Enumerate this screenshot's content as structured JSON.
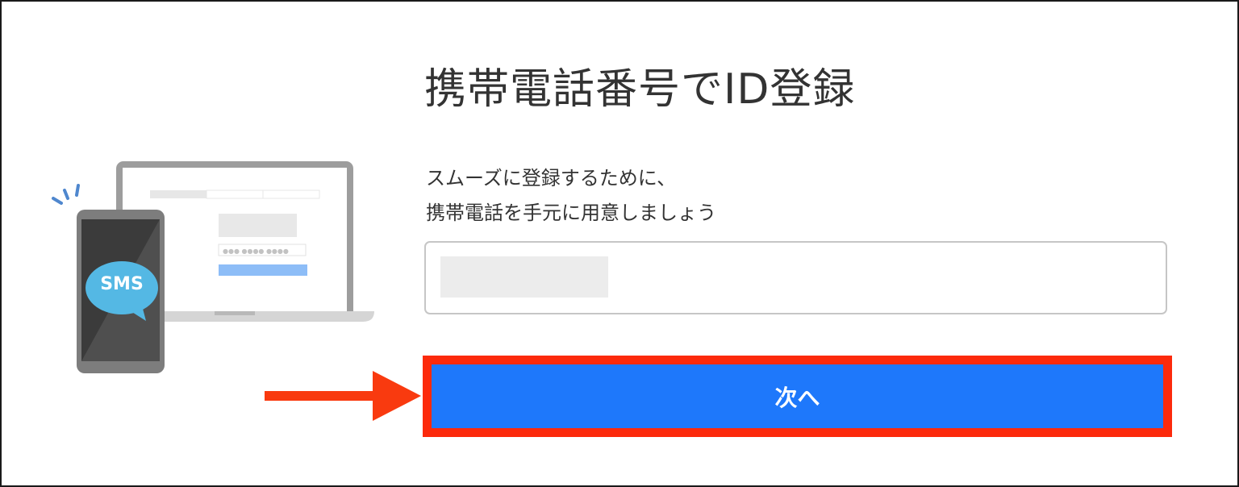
{
  "page": {
    "title": "携帯電話番号でID登録",
    "description_line1": "スムーズに登録するために、",
    "description_line2": "携帯電話を手元に用意しましょう",
    "phone_input": {
      "value": ""
    },
    "next_button_label": "次へ"
  },
  "illustration": {
    "sms_label": "SMS"
  },
  "colors": {
    "button": "#1e78fb",
    "highlight": "#fc2a0c",
    "arrow": "#f93a0f",
    "sms_bubble": "#54b8e4"
  }
}
